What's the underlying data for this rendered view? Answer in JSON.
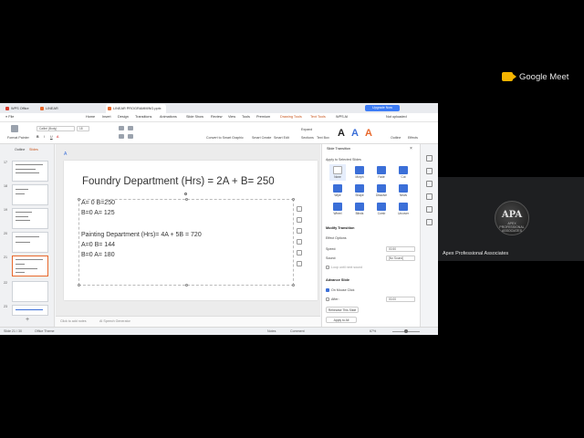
{
  "meet": {
    "brand": "Google Meet"
  },
  "participant": {
    "name": "Apex Professional Associates",
    "logo_text": "APA",
    "logo_sub": "APEX PROFESSIONAL ASSOCIATES"
  },
  "titlebar": {
    "tabs": [
      "WPS Office",
      "LINEAR PROGRAMMING.pptx",
      "LINEAR PROGRAMMING.pptx"
    ],
    "upgrade": "Upgrade Now"
  },
  "menu": {
    "file": "≡ File",
    "items": [
      "Home",
      "Insert",
      "Design",
      "Transitions",
      "Animations",
      "Slide Show",
      "Review",
      "View",
      "Tools",
      "Premium",
      "Drawing Tools",
      "Text Tools"
    ],
    "wps_ai": "WPS AI",
    "not_uploaded": "Not uploaded",
    "share": "Share"
  },
  "ribbon": {
    "format_painter": "Format Painter",
    "font": "Calibri (Body)",
    "font_size": "18",
    "convert": "Convert to Smart Graphic",
    "smart_create": "Smart Create",
    "smart_edit": "Smart Edit",
    "expand": "Expand",
    "sections": "Sections",
    "text_box": "Text Box",
    "outline": "Outline",
    "effects": "Effects"
  },
  "leftpane": {
    "tab_outline": "Outline",
    "tab_slides": "Slides",
    "slide_numbers": [
      "17",
      "18",
      "19",
      "20",
      "21",
      "22",
      "23"
    ]
  },
  "slide": {
    "title": "Foundry Department (Hrs) = 2A + B= 250",
    "lines": [
      "A= 0   B=250",
      "B=0   A= 125",
      "Painting Department (Hrs)= 4A + 5B = 720",
      "A=0  B= 144",
      "B=0  A= 180"
    ]
  },
  "notes": {
    "placeholder": "Click to add notes",
    "speech": "AI Speech Generator"
  },
  "rightpane": {
    "title": "Slide Transition",
    "apply_selected": "Apply to Selected Slides",
    "transitions": [
      "None",
      "Morph",
      "Fade",
      "Cut",
      "Wipe",
      "Shape",
      "Dissolve",
      "News",
      "Wheel",
      "Blinds",
      "Comb",
      "Uncover"
    ],
    "modify": "Modify Transition",
    "effect_options": "Effect Options",
    "speed_label": "Speed:",
    "speed_value": "00.50",
    "sound_label": "Sound:",
    "sound_value": "[No Sound]",
    "loop": "Loop until next sound",
    "advance": "Advance Slide",
    "on_click": "On Mouse Click",
    "after": "After:",
    "after_value": "00.00",
    "rehearse": "Rehearse This Slide",
    "apply_all": "Apply to All"
  },
  "status": {
    "slide": "Slide 21 / 30",
    "theme": "Office Theme",
    "notes": "Notes",
    "comment": "Comment",
    "zoom": "67%"
  }
}
